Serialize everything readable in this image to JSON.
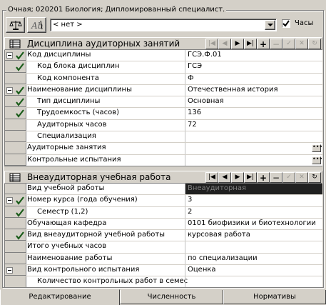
{
  "group_title": "Очная; 020201 Биология; Дипломированный специалист.",
  "toolbar": {
    "combo_value": "< нет >",
    "hours_checkbox_label": "Часы",
    "hours_checked": true
  },
  "panel1": {
    "title": "Дисциплина аудиторных занятий",
    "rows": [
      {
        "label": "Код дисциплины",
        "value": "ГСЭ.Ф.01",
        "expander": true,
        "check": true
      },
      {
        "label": "Код блока дисциплин",
        "value": "ГСЭ",
        "check": true
      },
      {
        "label": "Код компонента",
        "value": "Ф"
      },
      {
        "label": "Наименование дисциплины",
        "value": "Отечественная история",
        "expander": true,
        "check": true
      },
      {
        "label": "Тип дисциплины",
        "value": "Основная",
        "check": true
      },
      {
        "label": "Трудоемкость (часов)",
        "value": "136",
        "check": true
      },
      {
        "label": "Аудиторных часов",
        "value": "72"
      },
      {
        "label": "Специализация",
        "value": ""
      },
      {
        "label": "Аудиторные занятия",
        "value": "",
        "ellipsis": true
      },
      {
        "label": "Контрольные испытания",
        "value": "",
        "ellipsis": true
      }
    ]
  },
  "panel2": {
    "title": "Внеаудиторная учебная работа",
    "rows": [
      {
        "label": "Вид учебной работы",
        "value": "Внеаудиторная",
        "dark": true
      },
      {
        "label": "Номер курса (года обучения)",
        "value": "3",
        "expander": true,
        "check": true
      },
      {
        "label": "Семестр (1,2)",
        "value": "2",
        "check": true
      },
      {
        "label": "Обучающая кафедра",
        "value": "0101 биофизики и биотехнологии"
      },
      {
        "label": "Вид внеаудиторной учебной работы",
        "value": "курсовая работа",
        "check": true
      },
      {
        "label": "Итого учебных часов",
        "value": ""
      },
      {
        "label": "Наименование работы",
        "value": "по специализации"
      },
      {
        "label": "Вид контрольного испытания",
        "value": "Оценка",
        "expander": true
      },
      {
        "label": "Количество контрольных работ в семес",
        "value": ""
      }
    ]
  },
  "tabs": [
    "Редактирование",
    "Численность",
    "Нормативы"
  ],
  "active_tab": 0
}
